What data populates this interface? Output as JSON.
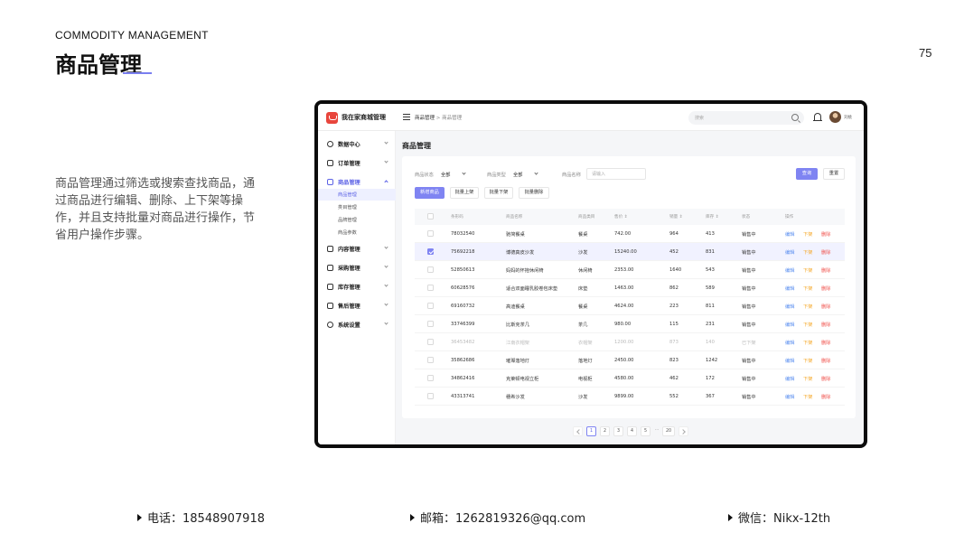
{
  "slide": {
    "subtitle": "COMMODITY MANAGEMENT",
    "title": "商品管理",
    "page_number": "75",
    "description": "商品管理通过筛选或搜索查找商品，通过商品进行编辑、删除、上下架等操作，并且支持批量对商品进行操作，节省用户操作步骤。",
    "accent_color": "#7a7ff0"
  },
  "contacts": {
    "phone": "电话：18548907918",
    "email": "邮箱：1262819326@qq.com",
    "wechat": "微信：Nikx-12th"
  },
  "app": {
    "name": "我在家商城管理",
    "breadcrumb_root": "商品管理",
    "breadcrumb_sep": ">",
    "breadcrumb_current": "商品管理",
    "search_placeholder": "搜索",
    "user_name": "刘桃",
    "brand_color": "#e8453c",
    "primary_color": "#7f84f2"
  },
  "sidebar": {
    "items": [
      {
        "label": "数据中心",
        "icon": "dashboard-icon"
      },
      {
        "label": "订单管理",
        "icon": "order-icon"
      },
      {
        "label": "商品管理",
        "icon": "goods-icon",
        "active": true,
        "children": [
          {
            "label": "商品管理",
            "active": true
          },
          {
            "label": "类目管理"
          },
          {
            "label": "品牌管理"
          },
          {
            "label": "商品参数"
          }
        ]
      },
      {
        "label": "内容管理",
        "icon": "content-icon"
      },
      {
        "label": "采购管理",
        "icon": "purchase-icon"
      },
      {
        "label": "库存管理",
        "icon": "stock-icon"
      },
      {
        "label": "售后管理",
        "icon": "after-sale-icon"
      },
      {
        "label": "系统设置",
        "icon": "settings-icon"
      }
    ]
  },
  "main": {
    "title": "商品管理",
    "filters": {
      "status_label": "商品状态",
      "status_value": "全部",
      "type_label": "商品类型",
      "type_value": "全部",
      "name_label": "商品名称",
      "name_placeholder": "请输入"
    },
    "buttons": {
      "query": "查询",
      "reset": "重置",
      "add": "新增商品",
      "batch_up": "批量上架",
      "batch_down": "批量下架",
      "batch_delete": "批量删除"
    },
    "table": {
      "columns": [
        "条形码",
        "商品名称",
        "商品类目",
        "售价 ⇕",
        "销量 ⇕",
        "库存 ⇕",
        "状态",
        "操作"
      ],
      "actions": {
        "edit": "编辑",
        "shelf": "下架",
        "delete": "删除"
      },
      "rows": [
        {
          "barcode": "78032540",
          "name": "驰简餐桌",
          "category": "餐桌",
          "price": "742.00",
          "sales": "964",
          "stock": "413",
          "status": "销售中"
        },
        {
          "barcode": "75692218",
          "name": "博德真皮沙发",
          "category": "沙发",
          "price": "15240.00",
          "sales": "452",
          "stock": "831",
          "status": "销售中",
          "selected": true
        },
        {
          "barcode": "52850613",
          "name": "妈妈的怀抱休闲椅",
          "category": "休闲椅",
          "price": "2353.00",
          "sales": "1640",
          "stock": "543",
          "status": "销售中"
        },
        {
          "barcode": "60628576",
          "name": "适合双面睡乳胶卷包床垫",
          "category": "床垫",
          "price": "1463.00",
          "sales": "862",
          "stock": "589",
          "status": "销售中"
        },
        {
          "barcode": "69160732",
          "name": "高迪餐桌",
          "category": "餐桌",
          "price": "4624.00",
          "sales": "223",
          "stock": "811",
          "status": "销售中"
        },
        {
          "barcode": "33746399",
          "name": "比斯克茶几",
          "category": "茶几",
          "price": "980.00",
          "sales": "115",
          "stock": "231",
          "status": "销售中"
        },
        {
          "barcode": "36453482",
          "name": "江南衣帽架",
          "category": "衣帽架",
          "price": "1200.00",
          "sales": "873",
          "stock": "140",
          "status": "已下架",
          "dim": true
        },
        {
          "barcode": "35862686",
          "name": "璀璨落地灯",
          "category": "落地灯",
          "price": "2450.00",
          "sales": "823",
          "stock": "1242",
          "status": "销售中"
        },
        {
          "barcode": "34862416",
          "name": "克莱顿电视立柜",
          "category": "电视柜",
          "price": "4580.00",
          "sales": "462",
          "stock": "172",
          "status": "销售中"
        },
        {
          "barcode": "43313741",
          "name": "穗希沙发",
          "category": "沙发",
          "price": "9899.00",
          "sales": "552",
          "stock": "367",
          "status": "销售中"
        }
      ]
    },
    "pagination": {
      "pages": [
        "1",
        "2",
        "3",
        "4",
        "5"
      ],
      "ellipsis": "···",
      "last": "20",
      "current": "1"
    }
  }
}
